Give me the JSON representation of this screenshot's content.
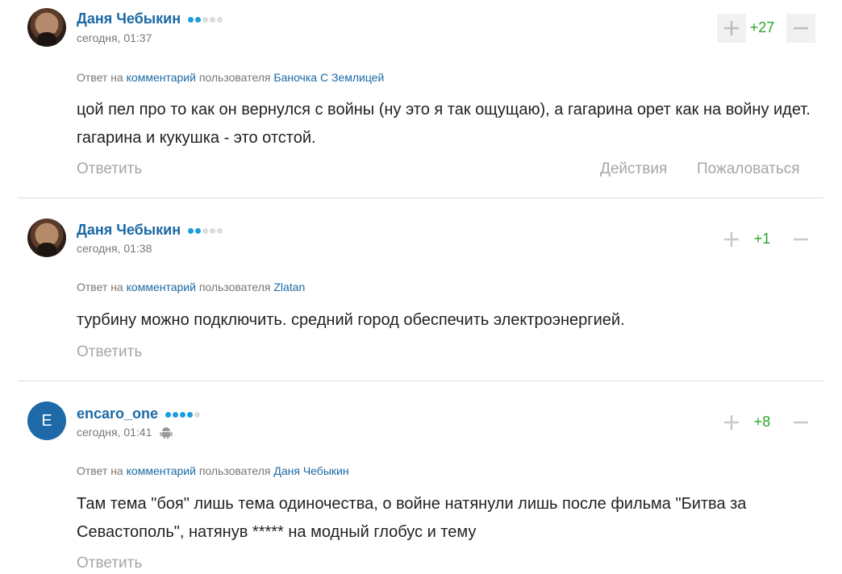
{
  "comments": [
    {
      "author": "Даня Чебыкин",
      "avatar": "photo",
      "rating_dots": [
        true,
        true,
        false,
        false,
        false
      ],
      "time": "сегодня, 01:37",
      "score": "+27",
      "reply_prefix": "Ответ на",
      "reply_link": "комментарий",
      "reply_mid": "пользователя",
      "reply_user": "Баночка С Землицей",
      "text": "цой пел про то как он вернулся с войны (ну это я так ощущаю), а гагарина орет как на войну идет. гагарина и кукушка - это отстой.",
      "reply_label": "Ответить",
      "actions_label": "Действия",
      "report_label": "Пожаловаться"
    },
    {
      "author": "Даня Чебыкин",
      "avatar": "photo",
      "rating_dots": [
        true,
        true,
        false,
        false,
        false
      ],
      "time": "сегодня, 01:38",
      "score": "+1",
      "reply_prefix": "Ответ на",
      "reply_link": "комментарий",
      "reply_mid": "пользователя",
      "reply_user": "Zlatan",
      "text": "турбину можно подключить. средний город обеспечить электроэнергией.",
      "reply_label": "Ответить"
    },
    {
      "author": "encaro_one",
      "avatar": "letter",
      "avatar_letter": "E",
      "device_icon": "android-icon",
      "rating_dots": [
        true,
        true,
        true,
        true,
        false
      ],
      "time": "сегодня, 01:41",
      "score": "+8",
      "reply_prefix": "Ответ на",
      "reply_link": "комментарий",
      "reply_mid": "пользователя",
      "reply_user": "Даня Чебыкин",
      "text": "Там тема \"боя\" лишь тема одиночества, о войне натянули лишь после фильма \"Битва за Севастополь\", натянув ***** на модный глобус и тему",
      "reply_label": "Ответить"
    }
  ],
  "colors": {
    "link": "#1a69a5",
    "score": "#2aa52a",
    "muted": "#a6a6a6",
    "dot_on": "#1d9ce0",
    "avatar_letter_bg": "#1e69a8"
  }
}
